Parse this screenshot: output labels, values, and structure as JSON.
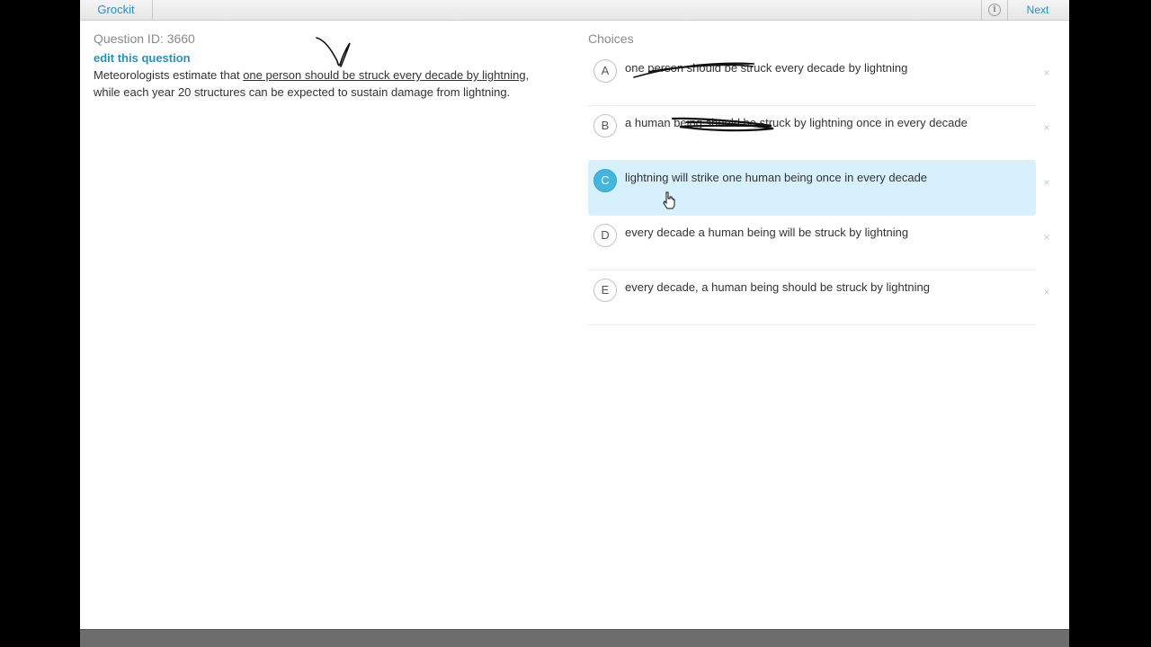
{
  "topbar": {
    "brand": "Grockit",
    "info_icon": "info-icon",
    "next_label": "Next"
  },
  "question": {
    "id_label": "Question ID: 3660",
    "edit_link": "edit this question",
    "text_before": "Meteorologists estimate that ",
    "text_underlined": "one person should be struck every decade by lightning",
    "text_after": ", while each year 20 structures can be expected to sustain damage from lightning."
  },
  "choices": {
    "heading": "Choices",
    "selected": "C",
    "items": [
      {
        "letter": "A",
        "text": "one person should be struck every decade by lightning"
      },
      {
        "letter": "B",
        "text": "a human being should be struck by lightning once in every decade"
      },
      {
        "letter": "C",
        "text": "lightning will strike one human being once in every decade"
      },
      {
        "letter": "D",
        "text": "every decade a human being will be struck by lightning"
      },
      {
        "letter": "E",
        "text": "every decade, a human being should be struck by lightning"
      }
    ],
    "close_glyph": "×"
  },
  "colors": {
    "accent": "#2a8fb8",
    "selected_bg": "#d6f1fb",
    "selected_badge": "#44b5dc"
  }
}
